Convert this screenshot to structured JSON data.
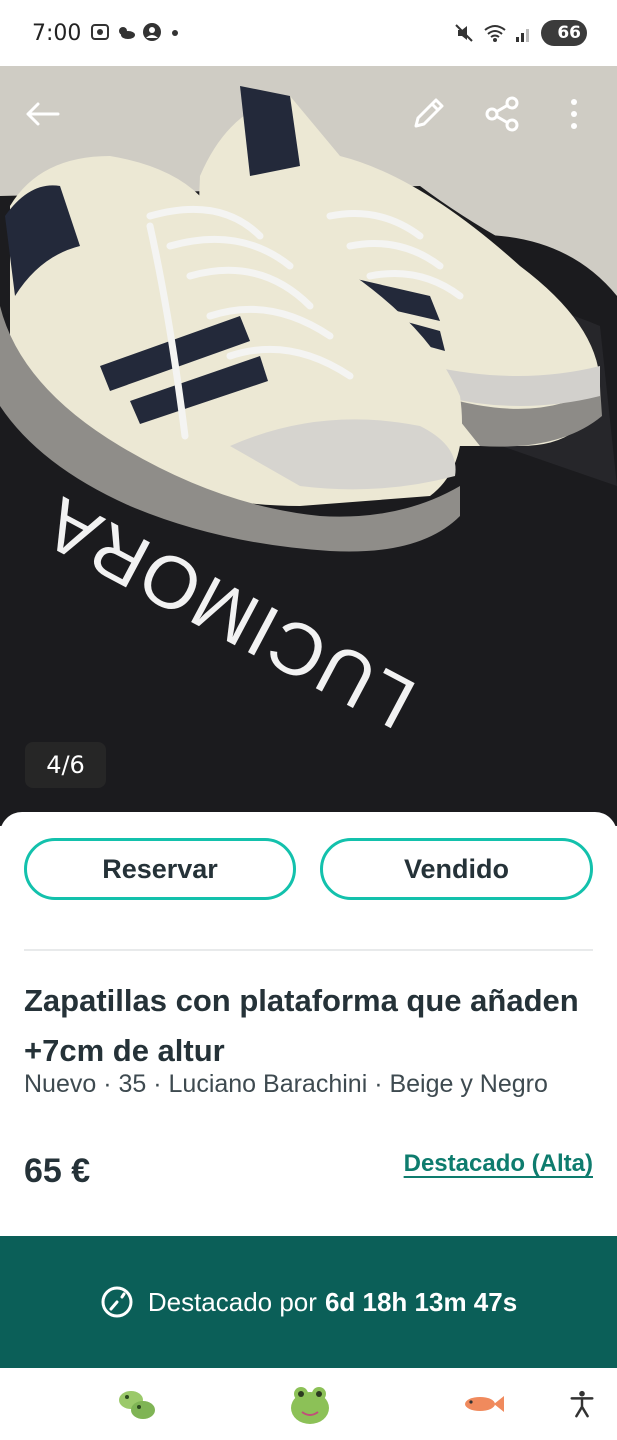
{
  "status_bar": {
    "time": "7:00",
    "battery": "66",
    "icons": [
      "screenshot-icon",
      "weather-icon",
      "account-icon",
      "dot-icon",
      "mute-icon",
      "wifi-icon",
      "signal-icon",
      "battery-icon"
    ]
  },
  "hero": {
    "image_counter": "4/6",
    "bag_brand": "LUCIMORA",
    "actions": [
      "back-arrow-icon",
      "edit-pencil-icon",
      "share-icon",
      "more-vertical-icon"
    ]
  },
  "actions": {
    "reserve_label": "Reservar",
    "sold_label": "Vendido"
  },
  "product": {
    "title": "Zapatillas con plataforma que añaden +7cm de altur",
    "meta": "Nuevo · 35 · Luciano Barachini · Beige y Negro",
    "price": "65 €",
    "featured_link": "Destacado (Alta)"
  },
  "banner": {
    "label": "Destacado por",
    "countdown": "6d 18h 13m 47s"
  },
  "colors": {
    "accent": "#13c1ac",
    "banner_bg": "#0b5f58",
    "link": "#0e7c6e",
    "text": "#253238"
  },
  "bottom_bar": {
    "items": [
      "frog-pair-icon",
      "frog-avatar-icon",
      "fish-icon",
      "accessibility-icon"
    ]
  }
}
